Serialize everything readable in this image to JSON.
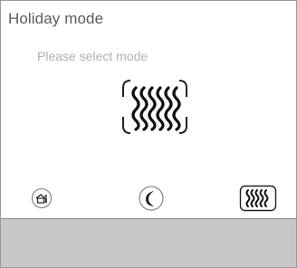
{
  "dialog": {
    "title": "Holiday mode",
    "subtitle": "Please select mode"
  },
  "selected_mode": {
    "icon": "heat-waves-icon"
  },
  "mode_buttons": [
    {
      "icon": "home-icon"
    },
    {
      "icon": "moon-icon"
    },
    {
      "icon": "heat-waves-icon"
    }
  ],
  "colors": {
    "text_title": "#5a5a5a",
    "text_subtitle": "#b0b0b0",
    "icon_stroke": "#222222",
    "icon_gray": "#8a8a8a",
    "footer_bg": "#c8c8c8",
    "border": "#9a9a9a"
  }
}
